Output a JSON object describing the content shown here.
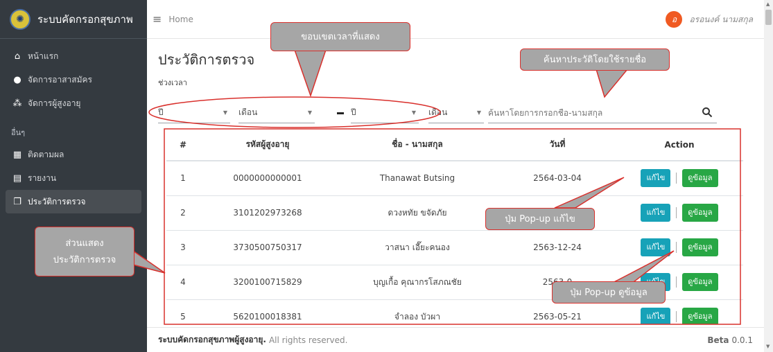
{
  "brand": {
    "title": "ระบบคัดกรอกสุขภาพ"
  },
  "sidebar": {
    "items": [
      {
        "label": "หน้าแรก",
        "icon": "home-icon"
      },
      {
        "label": "จัดการอาสาสมัคร",
        "icon": "user-cog-icon"
      },
      {
        "label": "จัดการผู้สูงอายุ",
        "icon": "users-icon"
      }
    ],
    "section_label": "อื่นๆ",
    "other_items": [
      {
        "label": "ติดตามผล",
        "icon": "calendar-icon"
      },
      {
        "label": "รายงาน",
        "icon": "file-icon"
      },
      {
        "label": "ประวัติการตรวจ",
        "icon": "copy-icon",
        "active": true
      }
    ]
  },
  "header": {
    "home": "Home",
    "user_name": "อรอนงค์ นามสกุล",
    "avatar_letter": "อ"
  },
  "page": {
    "title": "ประวัติการตรวจ",
    "period_label": "ช่วงเวลา"
  },
  "filters": {
    "year_from": "ปี",
    "month_from": "เดือน",
    "year_to": "ปี",
    "month_to": "เดือน",
    "search_placeholder": "ค้นหาโดยการกรอกชื่อ-นามสกุล"
  },
  "table": {
    "headers": [
      "#",
      "รหัสผู้สูงอายุ",
      "ชื่อ - นามสกุล",
      "วันที่",
      "Action"
    ],
    "edit_label": "แก้ไข",
    "view_label": "ดูข้อมูล",
    "rows": [
      {
        "no": "1",
        "id": "0000000000001",
        "name": "Thanawat Butsing",
        "date": "2564-03-04"
      },
      {
        "no": "2",
        "id": "3101202973268",
        "name": "ดวงหทัย ขจัดภัย",
        "date": "2564-"
      },
      {
        "no": "3",
        "id": "3730500750317",
        "name": "วาสนา เอี๊ยะคนอง",
        "date": "2563-12-24"
      },
      {
        "no": "4",
        "id": "3200100715829",
        "name": "บุญเกื้อ คุณากรโสภณชัย",
        "date": "2563-0"
      },
      {
        "no": "5",
        "id": "5620100018381",
        "name": "จำลอง บัวผา",
        "date": "2563-05-21"
      }
    ]
  },
  "footer": {
    "app_name": "ระบบคัดกรอกสุขภาพผู้สูงอายุ.",
    "rights": "All rights reserved.",
    "version_label": "Beta",
    "version": "0.0.1"
  },
  "annotations": {
    "time_range": "ขอบเขตเวลาที่แสดง",
    "search_by_name": "ค้นหาประวัติโดยใช้รายชื่อ",
    "display_line1": "ส่วนแสดง",
    "display_line2": "ประวัติการตรวจ",
    "edit_popup": "ปุ่ม Pop-up แก้ไข",
    "view_popup": "ปุ่ม Pop-up ดูข้อมูล"
  },
  "colors": {
    "sidebar_bg": "#343a40",
    "edit_btn": "#17a2b8",
    "view_btn": "#28a745",
    "annotation_border": "#d9302c",
    "annotation_fill": "#a6a6a6",
    "avatar": "#f05a22"
  }
}
